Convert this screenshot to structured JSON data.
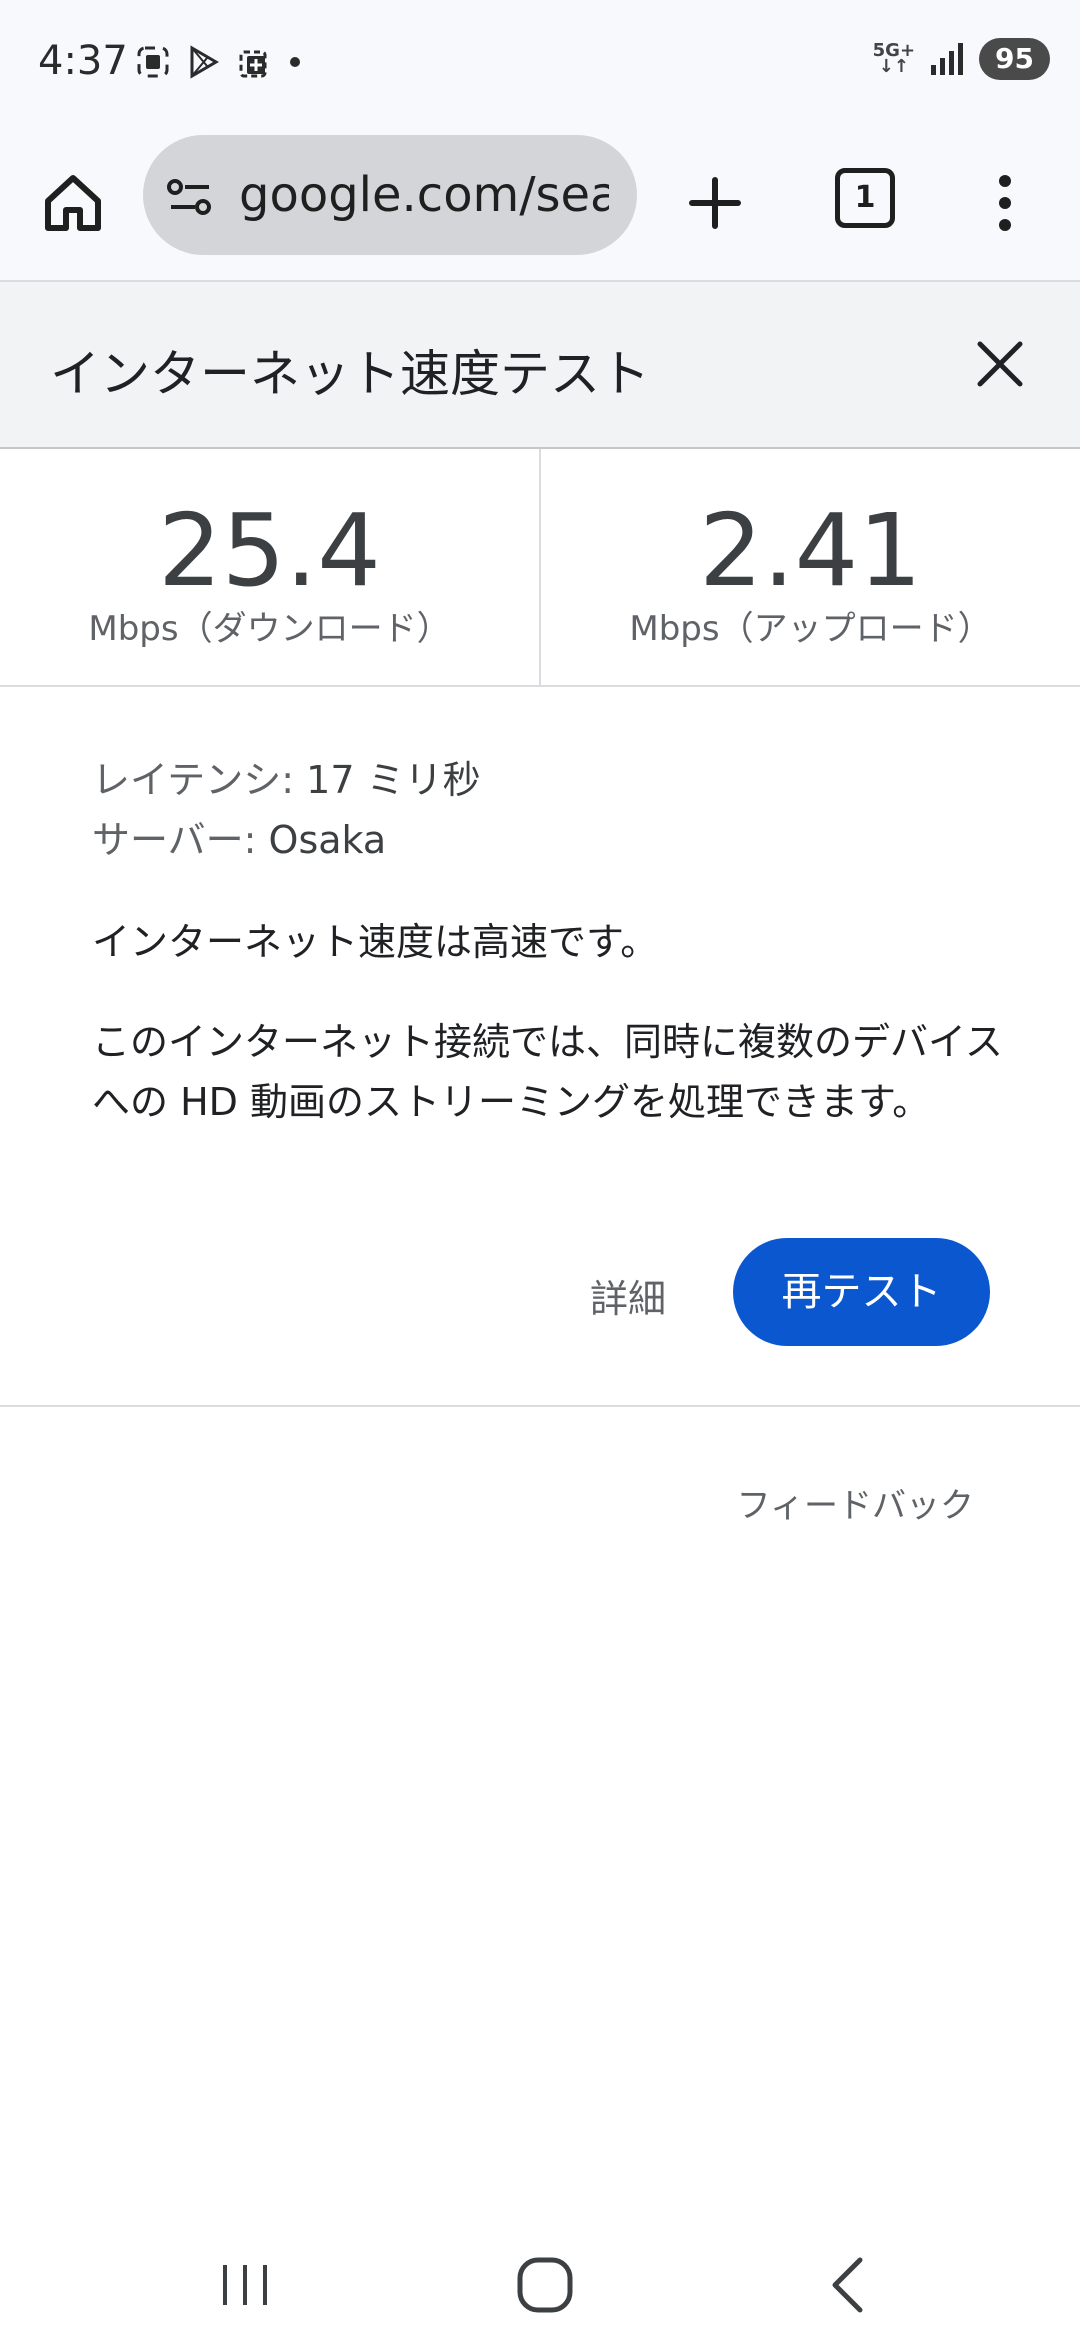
{
  "status_bar": {
    "time": "4:37",
    "network": "5G+",
    "battery": "95"
  },
  "browser": {
    "url": "google.com/search",
    "tab_count": "1"
  },
  "card": {
    "title": "インターネット速度テスト",
    "download": {
      "value": "25.4",
      "label": "Mbps（ダウンロード）"
    },
    "upload": {
      "value": "2.41",
      "label": "Mbps（アップロード）"
    },
    "latency_label": "レイテンシ:",
    "latency_value": "17 ミリ秒",
    "server_label": "サーバー:",
    "server_value": "Osaka",
    "summary": "インターネット速度は高速です。",
    "description": "このインターネット接続では、同時に複数のデバイスへの HD 動画のストリーミングを処理できます。",
    "details_button": "詳細",
    "retest_button": "再テスト",
    "feedback": "フィードバック"
  },
  "colors": {
    "accent": "#0b57d0",
    "header_bg": "#f1f3f4",
    "toolbar_bg": "#f8f9fd"
  }
}
